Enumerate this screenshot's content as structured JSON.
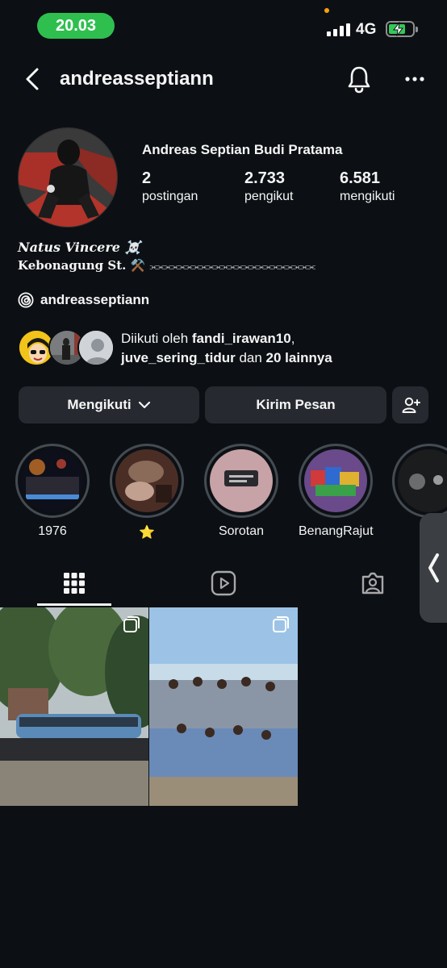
{
  "status_bar": {
    "time": "20.03",
    "network": "4G"
  },
  "header": {
    "username": "andreasseptiann"
  },
  "profile": {
    "full_name": "Andreas Septian Budi Pratama",
    "stats": [
      {
        "value": "2",
        "label": "postingan"
      },
      {
        "value": "2.733",
        "label": "pengikut"
      },
      {
        "value": "6.581",
        "label": "mengikuti"
      }
    ],
    "bio_line1": "Natus Vincere ☠️",
    "bio_line2": "Kebonagung St. ⚒️",
    "bio_line2_tail": "⫘⫘⫘⫘⫘⫘⫘⫘⫘⫘⫘⫘⫘⫘⫘⫘⫘⫘⫘⫘⫘⫘⫘",
    "threads_handle": "andreasseptiann"
  },
  "followed_by": {
    "prefix": "Diikuti oleh ",
    "user1": "fandi_irawan10",
    "comma": ",",
    "user2": "juve_sering_tidur",
    "middle": " dan ",
    "others": "20 lainnya"
  },
  "actions": {
    "following_label": "Mengikuti",
    "message_label": "Kirim Pesan"
  },
  "highlights": [
    {
      "label": "1976"
    },
    {
      "label": "⭐"
    },
    {
      "label": "Sorotan"
    },
    {
      "label": "BenangRajut"
    },
    {
      "label": ""
    }
  ],
  "tabs": [
    {
      "name": "grid-icon"
    },
    {
      "name": "reels-icon"
    },
    {
      "name": "tagged-icon"
    }
  ],
  "posts": [
    {
      "type": "carousel"
    },
    {
      "type": "carousel"
    }
  ],
  "colors": {
    "background": "#0c1014",
    "button": "#262a30",
    "time_pill": "#2fbf4f"
  }
}
